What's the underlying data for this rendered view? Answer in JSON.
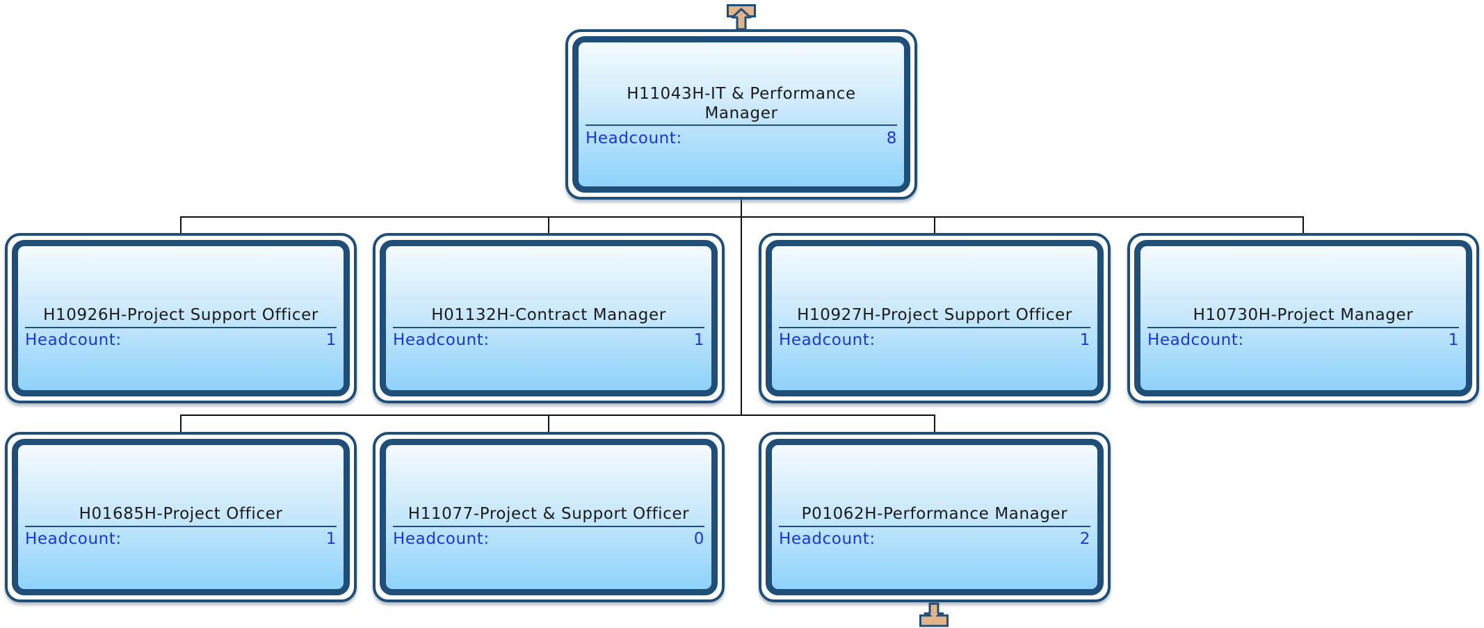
{
  "nav": {
    "up_icon": "arrow-up-icon",
    "down_icon": "arrow-down-icon"
  },
  "colors": {
    "card_border": "#1f4f78",
    "card_gradient_top": "#f4fbff",
    "card_gradient_bottom": "#8fd2fb",
    "headcount_text": "#1a37d6",
    "title_text": "#1a1a1a",
    "connector": "#111111",
    "arrow_fill": "#e2b48a"
  },
  "root": {
    "title": "H11043H-IT & Performance Manager",
    "headcount_label": "Headcount:",
    "headcount": "8"
  },
  "children": [
    {
      "title": "H10926H-Project Support Officer",
      "headcount_label": "Headcount:",
      "headcount": "1"
    },
    {
      "title": "H01132H-Contract Manager",
      "headcount_label": "Headcount:",
      "headcount": "1"
    },
    {
      "title": "H10927H-Project Support Officer",
      "headcount_label": "Headcount:",
      "headcount": "1"
    },
    {
      "title": "H10730H-Project Manager",
      "headcount_label": "Headcount:",
      "headcount": "1"
    },
    {
      "title": "H01685H-Project Officer",
      "headcount_label": "Headcount:",
      "headcount": "1"
    },
    {
      "title": "H11077-Project & Support Officer",
      "headcount_label": "Headcount:",
      "headcount": "0"
    },
    {
      "title": "P01062H-Performance Manager",
      "headcount_label": "Headcount:",
      "headcount": "2"
    }
  ]
}
